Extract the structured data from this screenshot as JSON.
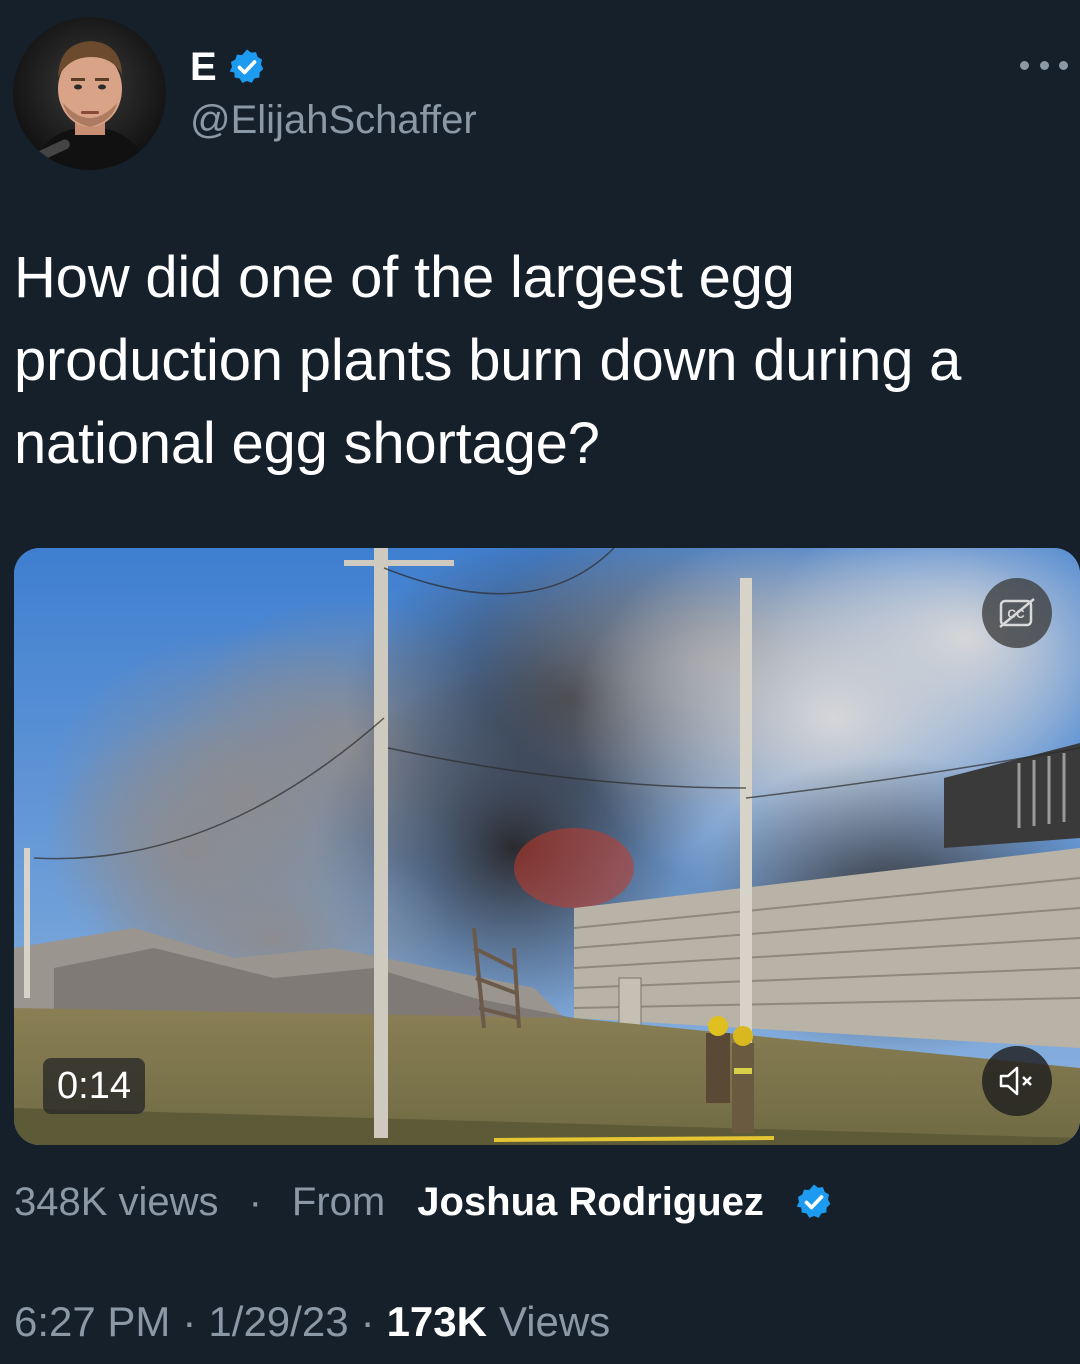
{
  "author": {
    "display_name": "E",
    "handle": "@ElijahSchaffer",
    "verified": true,
    "avatar_icon": "avatar-photo"
  },
  "tweet": {
    "text": "How did one of the largest egg production plants burn down during a national egg shortage?"
  },
  "media": {
    "type": "video",
    "duration": "0:14",
    "cc_icon": "closed-captions-icon",
    "mute_icon": "muted-speaker-icon",
    "views": "348K views",
    "separator": "·",
    "from_label": "From",
    "source_name": "Joshua Rodriguez",
    "source_verified": true
  },
  "footer": {
    "time": "6:27 PM",
    "date": "1/29/23",
    "separator": "·",
    "view_count": "173K",
    "views_label": "Views"
  },
  "colors": {
    "background": "#15202b",
    "text_primary": "#ffffff",
    "text_secondary": "#8b98a5",
    "verified_blue": "#1d9bf0"
  }
}
